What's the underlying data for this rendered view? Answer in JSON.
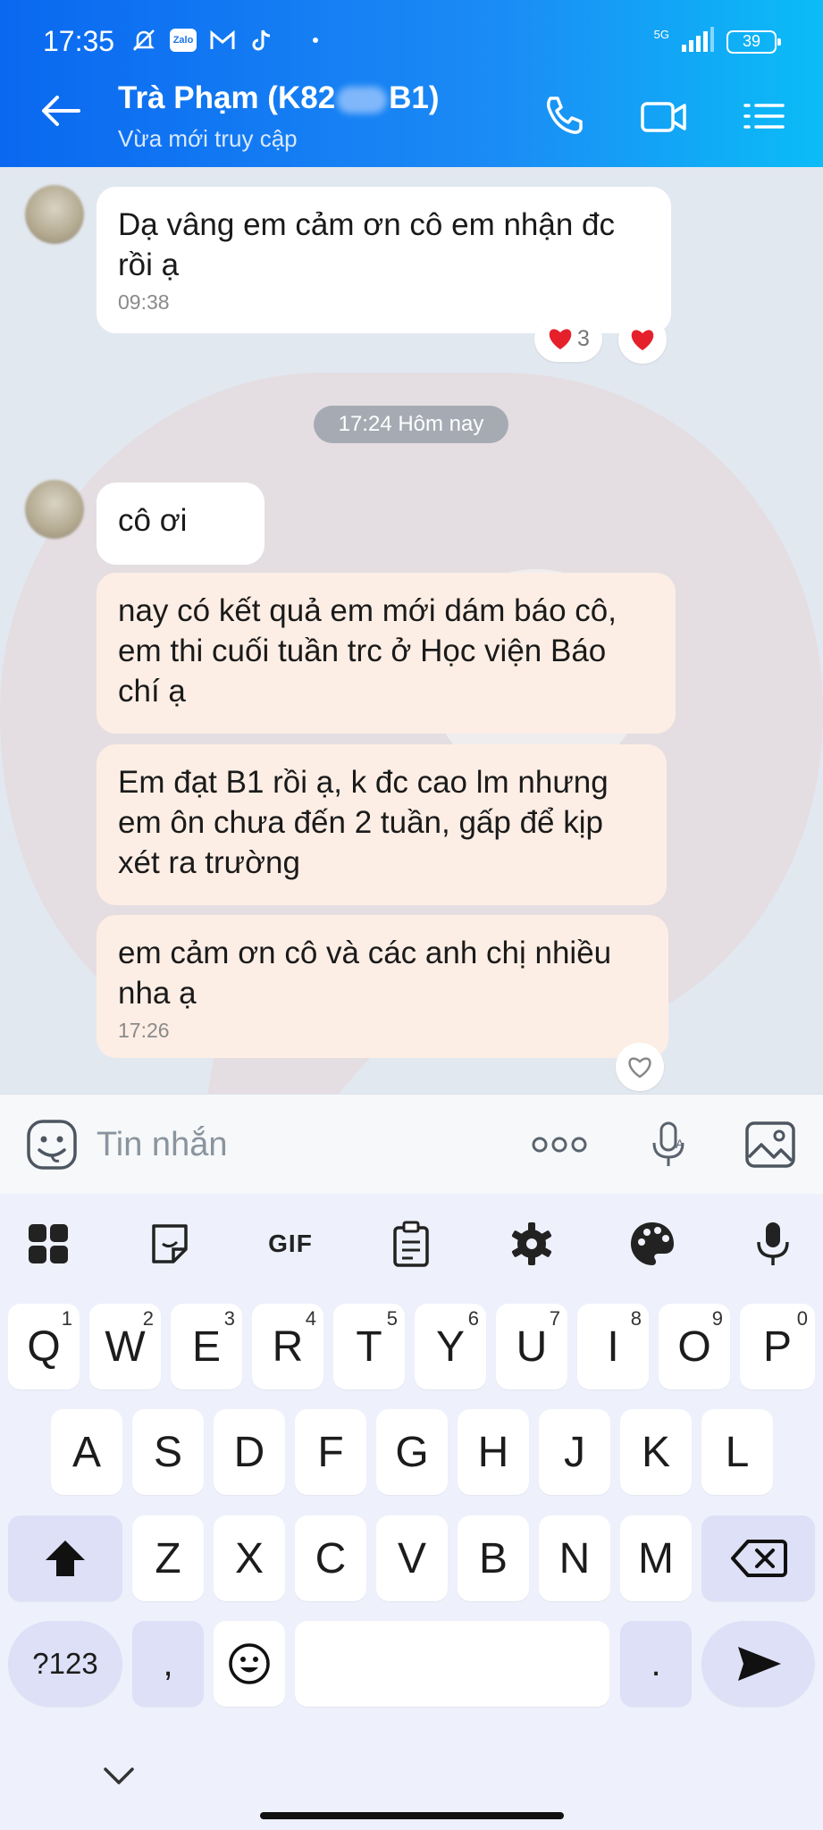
{
  "status_bar": {
    "time": "17:35",
    "zalo": "Zalo",
    "network": "5G",
    "battery": "39"
  },
  "header": {
    "name_left": "Trà Phạm (K82",
    "name_right": "B1)",
    "status": "Vừa mới truy cập"
  },
  "messages": [
    {
      "text": "Dạ vâng em cảm ơn cô em nhận đc rồi ạ",
      "time": "09:38",
      "style": "white"
    },
    {
      "text": "cô ơi",
      "style": "white"
    },
    {
      "text": "nay có kết quả em mới dám báo cô, em thi cuối tuần trc ở Học viện Báo chí ạ",
      "style": "peach"
    },
    {
      "text": "Em đạt B1 rồi ạ, k đc cao lm nhưng em ôn chưa đến 2 tuần, gấp để  kịp xét ra trường",
      "style": "peach"
    },
    {
      "text": "em cảm ơn cô và các anh chị nhiều nha ạ",
      "time": "17:26",
      "style": "peach"
    }
  ],
  "reactions": {
    "count": "3"
  },
  "date_separator": "17:24 Hôm nay",
  "input": {
    "placeholder": "Tin nhắn",
    "more": "ooo"
  },
  "keyboard": {
    "gif_label": "GIF",
    "row1": [
      "Q",
      "W",
      "E",
      "R",
      "T",
      "Y",
      "U",
      "I",
      "O",
      "P"
    ],
    "row1_sup": [
      "1",
      "2",
      "3",
      "4",
      "5",
      "6",
      "7",
      "8",
      "9",
      "0"
    ],
    "row2": [
      "A",
      "S",
      "D",
      "F",
      "G",
      "H",
      "J",
      "K",
      "L"
    ],
    "row3": [
      "Z",
      "X",
      "C",
      "V",
      "B",
      "N",
      "M"
    ],
    "sym_key": "?123",
    "comma": ",",
    "period": "."
  },
  "colors": {
    "header_start": "#0a68f0",
    "header_end": "#0bbcf7",
    "chat_bg": "#e2e8f0",
    "bubble_peach": "#fdeee5",
    "heart": "#e5202b"
  }
}
